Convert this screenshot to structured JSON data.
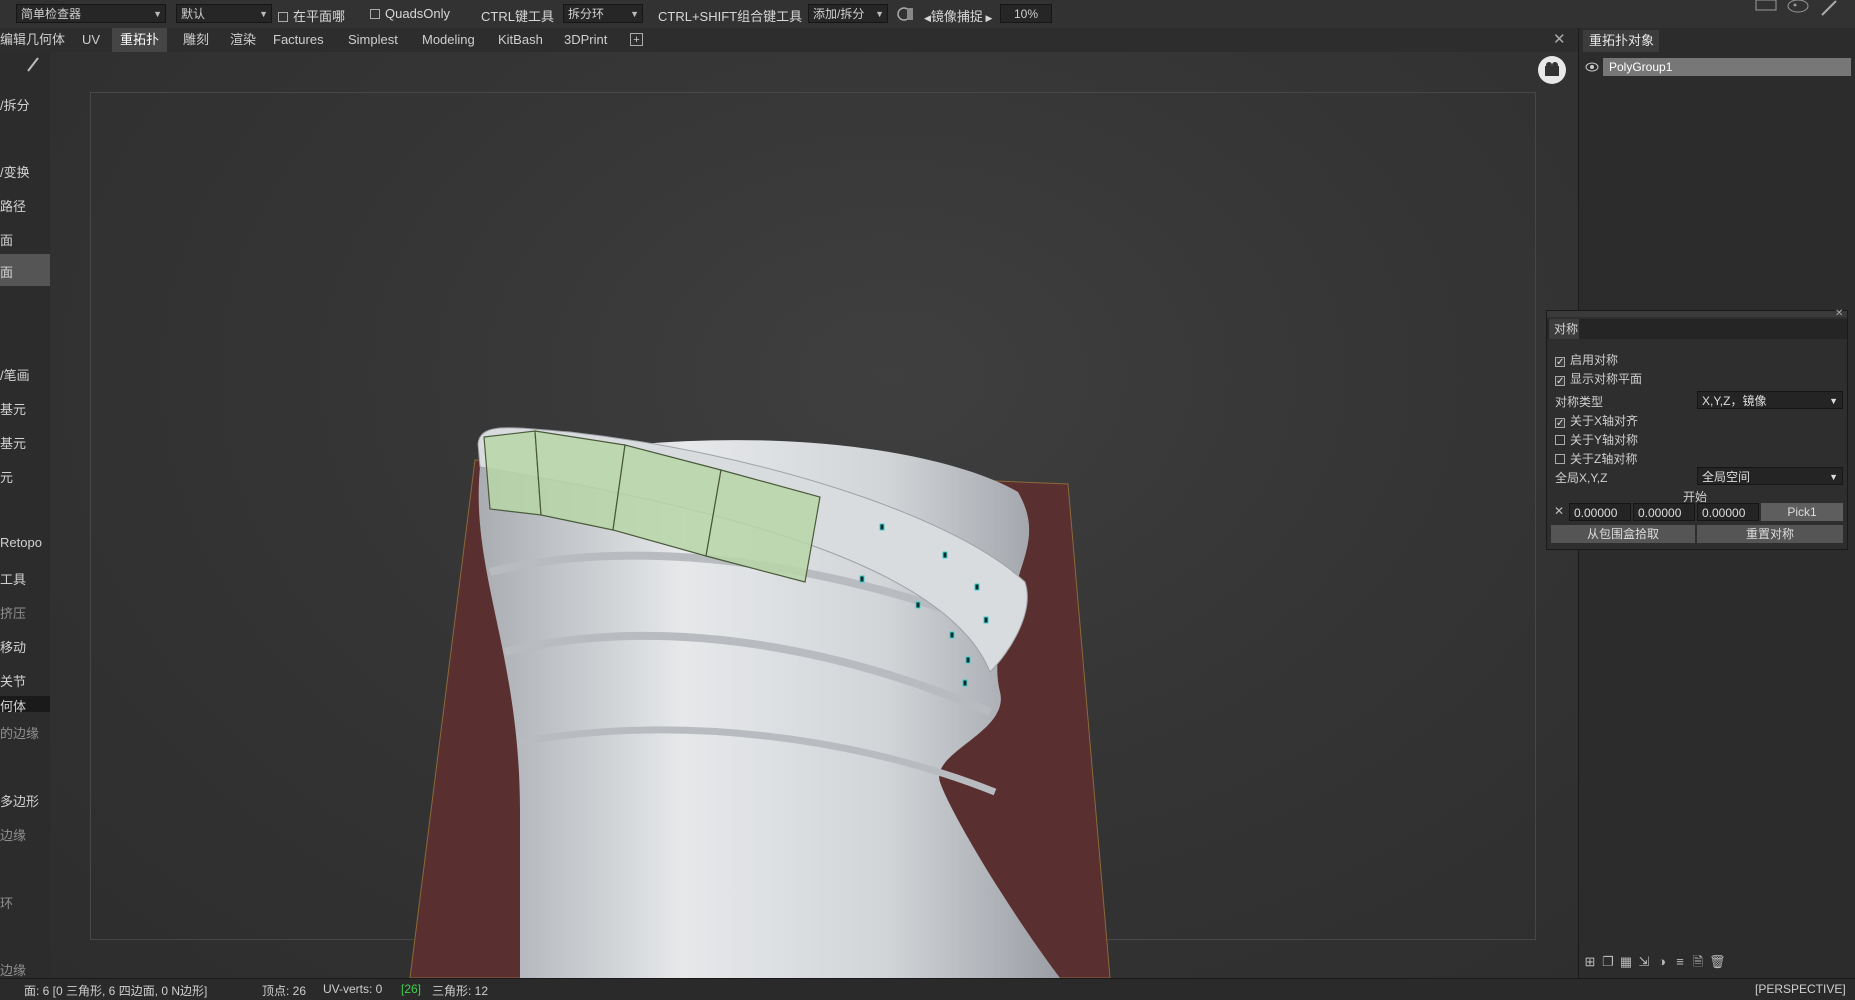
{
  "toolbar": {
    "inspector_dropdown": "简单检查器",
    "default_dropdown": "默认",
    "on_plane_label": "在平面哪",
    "quads_only_label": "QuadsOnly",
    "ctrl_tool_label": "CTRL键工具",
    "ctrl_tool_dropdown": "拆分环",
    "ctrl_shift_label": "CTRL+SHIFT组合键工具",
    "ctrl_shift_dropdown": "添加/拆分",
    "mirror_snap_label": "镜像捕捉",
    "zoom_value": "10%"
  },
  "tabs": [
    {
      "label": "编辑几何体"
    },
    {
      "label": "UV"
    },
    {
      "label": "重拓扑"
    },
    {
      "label": "雕刻"
    },
    {
      "label": "渲染"
    },
    {
      "label": "Factures"
    },
    {
      "label": "Simplest"
    },
    {
      "label": "Modeling"
    },
    {
      "label": "KitBash"
    },
    {
      "label": "3DPrint"
    }
  ],
  "left_panel": {
    "items": [
      "/拆分",
      "/变换",
      "路径",
      "面",
      "面",
      "/笔画",
      "基元",
      "基元",
      "元",
      "Retopo",
      "工具",
      "挤压",
      "移动",
      "关节",
      "何体",
      "的边缘",
      "多边形",
      "边缘",
      "环",
      "边缘"
    ]
  },
  "right_panel": {
    "tab_label": "重拓扑对象",
    "polygroup": "PolyGroup1"
  },
  "symmetry": {
    "tab_label": "对称",
    "enable_label": "启用对称",
    "show_plane_label": "显示对称平面",
    "type_label": "对称类型",
    "type_value": "X,Y,Z，镜像",
    "x_axis_label": "关于X轴对齐",
    "y_axis_label": "关于Y轴对称",
    "z_axis_label": "关于Z轴对称",
    "global_label": "全局X,Y,Z",
    "global_value": "全局空间",
    "start_label": "开始",
    "x_value": "0.00000",
    "y_value": "0.00000",
    "z_value": "0.00000",
    "pick_label": "Pick1",
    "from_bbox_label": "从包围盒拾取",
    "reset_label": "重置对称"
  },
  "status": {
    "faces": "面: 6 [0 三角形, 6 四边面, 0 N边形]",
    "vertices": "顶点: 26",
    "uv_verts": "UV-verts: 0",
    "uv_count": "[26]",
    "triangles": "三角形: 12",
    "view_mode": "[PERSPECTIVE]"
  }
}
